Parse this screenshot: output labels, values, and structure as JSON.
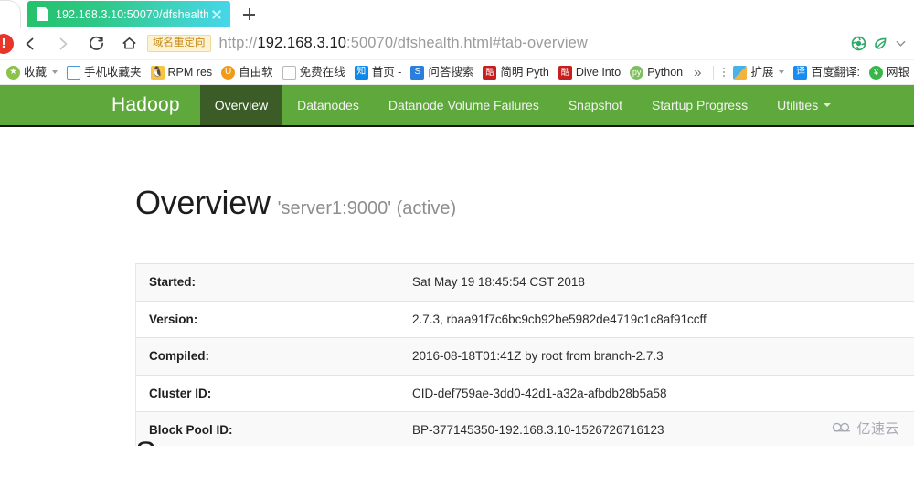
{
  "browser": {
    "tab": {
      "title": "192.168.3.10:50070/dfshealth",
      "favicon": "document-icon",
      "close": "close-icon"
    },
    "new_tab_label": "+",
    "toolbar": {
      "alert_badge": "!",
      "back": "back-arrow-icon",
      "forward": "forward-arrow-icon",
      "reload": "reload-icon",
      "home": "home-icon",
      "redirect_chip": "域名重定向",
      "url_scheme": "http://",
      "url_host": "192.168.3.10",
      "url_path": ":50070/dfshealth.html#tab-overview"
    },
    "bookmarks": [
      {
        "icon": "favorites-star-icon",
        "label": "收藏",
        "caret": true
      },
      {
        "icon": "phone-icon",
        "label": "手机收藏夹",
        "caret": false
      },
      {
        "icon": "tux-icon",
        "label": "RPM res",
        "caret": false
      },
      {
        "icon": "ubuntu-icon",
        "label": "自由软",
        "caret": false
      },
      {
        "icon": "page-icon",
        "label": "免费在线",
        "caret": false
      },
      {
        "icon": "zhihu-icon",
        "label": "首页 -",
        "caret": false
      },
      {
        "icon": "sogou-icon",
        "label": "问答搜索",
        "caret": false
      },
      {
        "icon": "kuku-icon",
        "label": "简明 Pyth",
        "caret": false
      },
      {
        "icon": "kuku-icon",
        "label": "Dive Into",
        "caret": false
      },
      {
        "icon": "python-icon",
        "label": "Python",
        "caret": false
      }
    ],
    "bookmarks_overflow": "»",
    "bookmarks_right": [
      {
        "icon": "extensions-icon",
        "label": "扩展",
        "caret": true
      },
      {
        "icon": "translate-icon",
        "label": "百度翻译:",
        "caret": false
      },
      {
        "icon": "shield-icon",
        "label": "网银",
        "caret": false
      }
    ]
  },
  "hadoop": {
    "brand": "Hadoop",
    "nav": [
      {
        "label": "Overview",
        "active": true,
        "caret": false
      },
      {
        "label": "Datanodes",
        "active": false,
        "caret": false
      },
      {
        "label": "Datanode Volume Failures",
        "active": false,
        "caret": false
      },
      {
        "label": "Snapshot",
        "active": false,
        "caret": false
      },
      {
        "label": "Startup Progress",
        "active": false,
        "caret": false
      },
      {
        "label": "Utilities",
        "active": false,
        "caret": true
      }
    ],
    "title": "Overview",
    "subtitle": "'server1:9000' (active)",
    "overview_rows": [
      {
        "key": "Started:",
        "value": "Sat May 19 18:45:54 CST 2018"
      },
      {
        "key": "Version:",
        "value": "2.7.3, rbaa91f7c6bc9cb92be5982de4719c1c8af91ccff"
      },
      {
        "key": "Compiled:",
        "value": "2016-08-18T01:41Z by root from branch-2.7.3"
      },
      {
        "key": "Cluster ID:",
        "value": "CID-def759ae-3dd0-42d1-a32a-afbdb28b5a58"
      },
      {
        "key": "Block Pool ID:",
        "value": "BP-377145350-192.168.3.10-1526726716123"
      }
    ],
    "next_section": "S"
  },
  "watermark": {
    "text": "亿速云",
    "icon": "cloud-icon"
  },
  "colors": {
    "navbar_green": "#5fa83c",
    "navbar_active": "#3c5c27",
    "tab_gradient_start": "#25c16a",
    "tab_gradient_end": "#46d6ec",
    "alert_red": "#e8352a",
    "chip_bg": "#fdf3d2",
    "chip_text": "#c98b1c"
  }
}
